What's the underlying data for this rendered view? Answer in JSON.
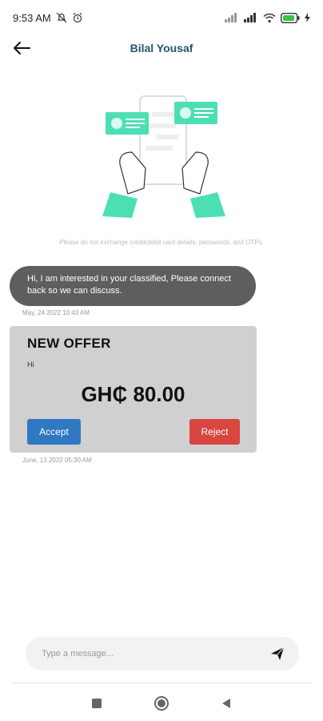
{
  "status_bar": {
    "time": "9:53 AM",
    "icons": [
      "notification-off-icon",
      "alarm-icon",
      "signal-icon",
      "signal-icon",
      "wifi-icon",
      "battery-icon",
      "charging-icon"
    ]
  },
  "header": {
    "back_icon": "arrow-left-icon",
    "title": "Bilal Yousaf"
  },
  "illustration": {
    "accent": "#4ddfb4"
  },
  "disclaimer": "Please do not exchange credit/debit card details, passwords, and OTPs.",
  "messages": [
    {
      "text": "Hi, I am interested in your classified, Please connect back so we can discuss.",
      "timestamp": "May, 24 2022 10:43 AM"
    }
  ],
  "offer": {
    "title": "NEW OFFER",
    "note": "Hi",
    "price": "GH₵ 80.00",
    "accept_label": "Accept",
    "reject_label": "Reject",
    "timestamp": "June, 13 2022 05:30 AM",
    "accept_color": "#2f78c2",
    "reject_color": "#d9453f"
  },
  "composer": {
    "placeholder": "Type a message...",
    "send_icon": "send-icon"
  },
  "nav_bar": {
    "icons": [
      "recent-apps-icon",
      "home-icon",
      "back-icon"
    ]
  }
}
